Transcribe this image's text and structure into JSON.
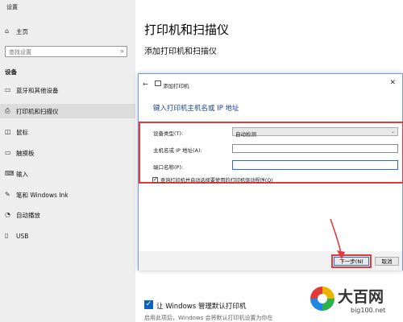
{
  "window": {
    "title": "设置"
  },
  "sidebar": {
    "home": {
      "label": "主页",
      "icon": "home-icon"
    },
    "search": {
      "placeholder": "查找设置",
      "icon": "search-icon"
    },
    "section_title": "设备",
    "items": [
      {
        "label": "蓝牙和其他设备",
        "icon": "bluetooth-icon",
        "glyph": "▭"
      },
      {
        "label": "打印机和扫描仪",
        "icon": "printer-icon",
        "glyph": "⎙",
        "active": true
      },
      {
        "label": "鼠标",
        "icon": "mouse-icon",
        "glyph": "◫"
      },
      {
        "label": "触摸板",
        "icon": "touchpad-icon",
        "glyph": "▭"
      },
      {
        "label": "输入",
        "icon": "keyboard-icon",
        "glyph": "⌨"
      },
      {
        "label": "笔和 Windows Ink",
        "icon": "pen-icon",
        "glyph": "✎"
      },
      {
        "label": "自动播放",
        "icon": "autoplay-icon",
        "glyph": "◔"
      },
      {
        "label": "USB",
        "icon": "usb-icon",
        "glyph": "▯"
      }
    ]
  },
  "main": {
    "title": "打印机和扫描仪",
    "subtitle": "添加打印机和扫描仪",
    "bottom_checkbox_label": "让 Windows 管理默认打印机",
    "bottom_checkbox_checked": true,
    "bottom_description": "启用此项后，Windows 会将默认打印机设置为你在"
  },
  "dialog": {
    "title": "添加打印机",
    "back_glyph": "←",
    "close_glyph": "✕",
    "heading": "键入打印机主机名或 IP 地址",
    "device_type_label": "设备类型(T):",
    "device_type_value": "自动检测",
    "hostname_label": "主机名或 IP 地址(A):",
    "hostname_value": "",
    "port_label": "端口名称(P):",
    "port_value": "",
    "query_label": "查询打印机并自动选择要使用的打印机驱动程序(Q)",
    "query_checked": true,
    "next_button": "下一步(N)",
    "cancel_button": "取消"
  },
  "watermark": {
    "brand": "大百网",
    "url": "big100.net"
  },
  "colors": {
    "accent": "#0b62c4",
    "highlight_red": "#e03a3a",
    "dialog_heading": "#1a3e8c"
  }
}
